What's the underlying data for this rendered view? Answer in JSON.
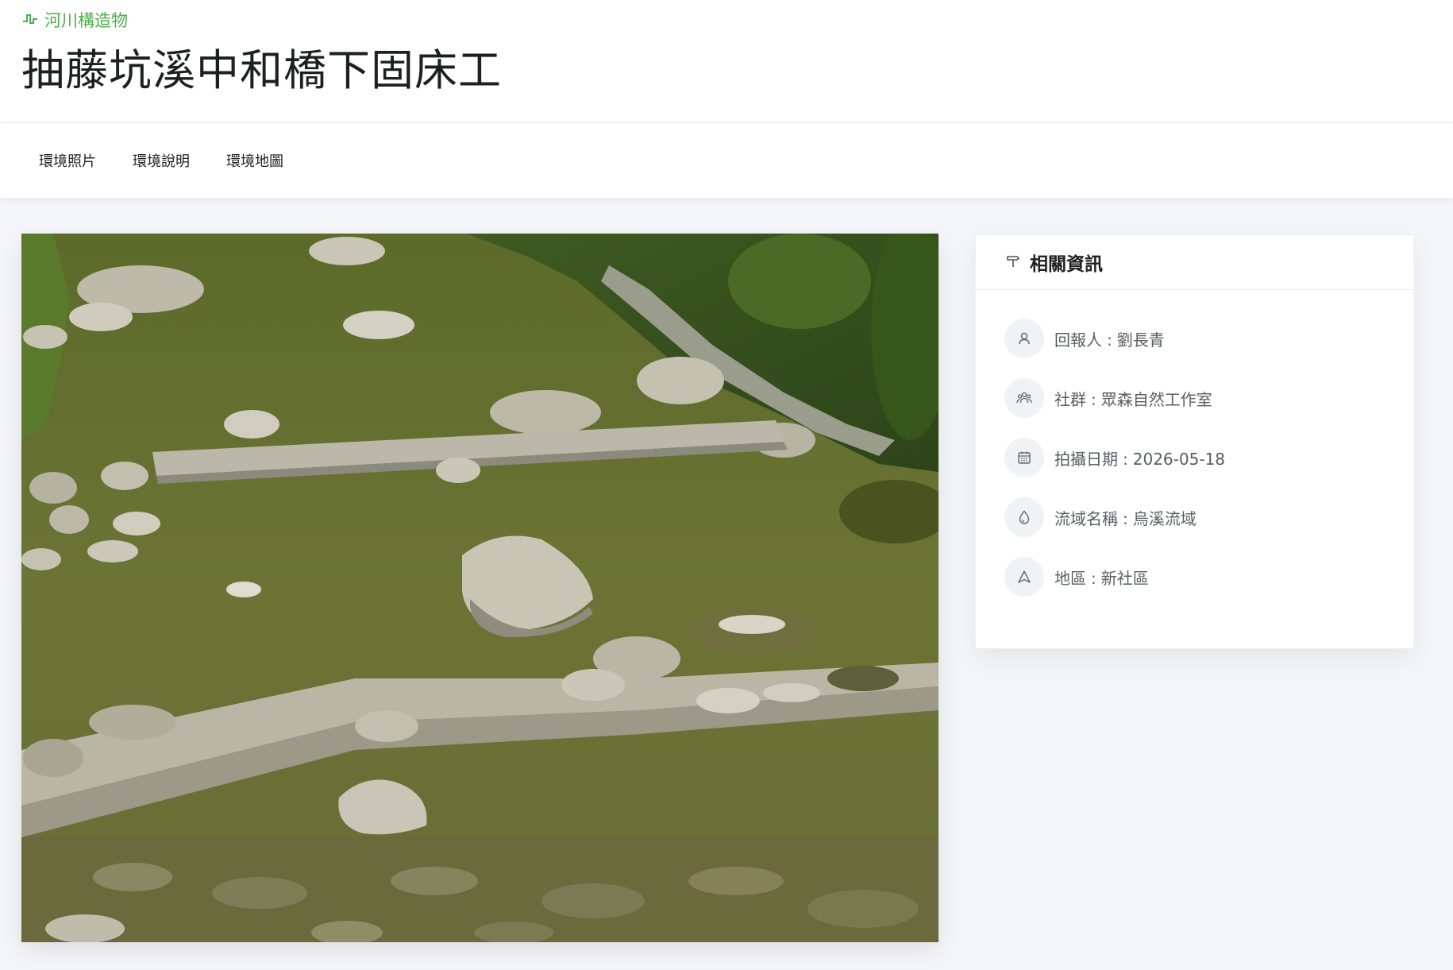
{
  "header": {
    "category_label": "河川構造物",
    "category_icon": "pulse-line-icon",
    "category_color": "#4cae4c",
    "title": "抽藤坑溪中和橋下固床工"
  },
  "tabs": [
    {
      "label": "環境照片"
    },
    {
      "label": "環境說明"
    },
    {
      "label": "環境地圖"
    }
  ],
  "photo": {
    "subject": "stream with concrete check dams, rocks and vegetation"
  },
  "info_card": {
    "title": "相關資訊",
    "title_icon": "signpost-icon",
    "separator": ":",
    "items": [
      {
        "icon": "user-icon",
        "label": "回報人",
        "value": "劉長青"
      },
      {
        "icon": "group-icon",
        "label": "社群",
        "value": "眾森自然工作室"
      },
      {
        "icon": "calendar-icon",
        "label": "拍攝日期",
        "value": "2026-05-18"
      },
      {
        "icon": "water-drop-icon",
        "label": "流域名稱",
        "value": "烏溪流域"
      },
      {
        "icon": "location-arrow-icon",
        "label": "地區",
        "value": "新社區"
      }
    ]
  }
}
